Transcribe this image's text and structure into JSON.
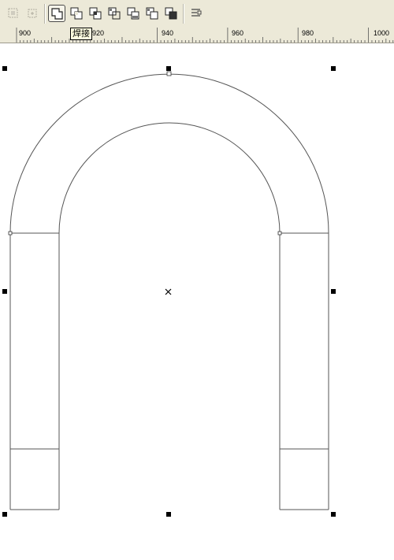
{
  "toolbar": {
    "buttons": [
      {
        "name": "reset-select-icon",
        "enabled": false
      },
      {
        "name": "edit-select-icon",
        "enabled": false
      },
      {
        "name": "weld-icon",
        "enabled": true,
        "active": true
      },
      {
        "name": "trim-icon",
        "enabled": true
      },
      {
        "name": "intersect-icon",
        "enabled": true
      },
      {
        "name": "simplify-icon",
        "enabled": true
      },
      {
        "name": "front-minus-back-icon",
        "enabled": true
      },
      {
        "name": "back-minus-front-icon",
        "enabled": true
      },
      {
        "name": "create-boundary-icon",
        "enabled": true
      },
      {
        "name": "align-distribute-icon",
        "enabled": true
      }
    ],
    "tooltip": "焊接"
  },
  "ruler": {
    "labels": [
      "900",
      "920",
      "940",
      "960",
      "980",
      "1000"
    ]
  },
  "colors": {
    "toolbar_bg": "#ece9d8",
    "outline": "#555555",
    "handle": "#000000"
  }
}
